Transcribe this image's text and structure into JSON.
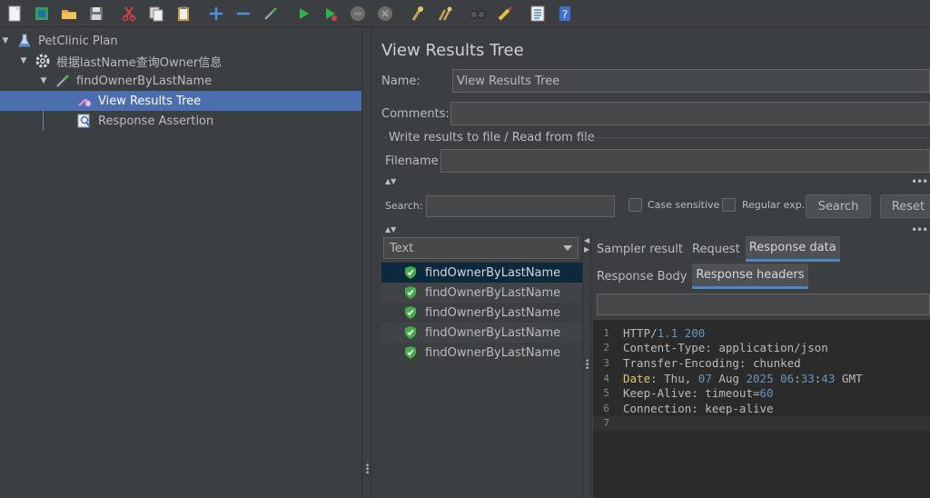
{
  "toolbar": {
    "buttons": [
      "new-icon",
      "templates-icon",
      "open-icon",
      "save-icon",
      "cut-icon",
      "copy-icon",
      "paste-icon",
      "expand-icon",
      "collapse-icon",
      "toggle-icon",
      "start-icon",
      "start-no-pause-icon",
      "stop-icon",
      "shutdown-icon",
      "clear-icon",
      "clear-all-icon",
      "search-icon",
      "reset-search-icon",
      "function-helper-icon",
      "help-icon"
    ]
  },
  "tree": {
    "items": [
      {
        "label": "PetClinic Plan"
      },
      {
        "label": "根据lastName查询Owner信息"
      },
      {
        "label": "findOwnerByLastName"
      },
      {
        "label": "View Results Tree"
      },
      {
        "label": "Response Assertion"
      }
    ]
  },
  "panel": {
    "title": "View Results Tree",
    "name_label": "Name:",
    "name_value": "View Results Tree",
    "comments_label": "Comments:",
    "group_title": "Write results to file / Read from file",
    "filename_label": "Filename",
    "search_label": "Search:",
    "case_sensitive": "Case sensitive",
    "regular_exp": "Regular exp.",
    "search_button": "Search",
    "reset_button": "Reset"
  },
  "renderer": {
    "selected": "Text"
  },
  "results": [
    {
      "label": "findOwnerByLastName"
    },
    {
      "label": "findOwnerByLastName"
    },
    {
      "label": "findOwnerByLastName"
    },
    {
      "label": "findOwnerByLastName"
    },
    {
      "label": "findOwnerByLastName"
    }
  ],
  "tabs": {
    "top": [
      "Sampler result",
      "Request",
      "Response data"
    ],
    "sub": [
      "Response Body",
      "Response headers"
    ]
  },
  "code": {
    "line_numbers": [
      "1",
      "2",
      "3",
      "4",
      "5",
      "6",
      "7"
    ]
  },
  "colors": {
    "selection": "#4b6eaf",
    "accent": "#4a88c7",
    "success": "#3fae45"
  }
}
